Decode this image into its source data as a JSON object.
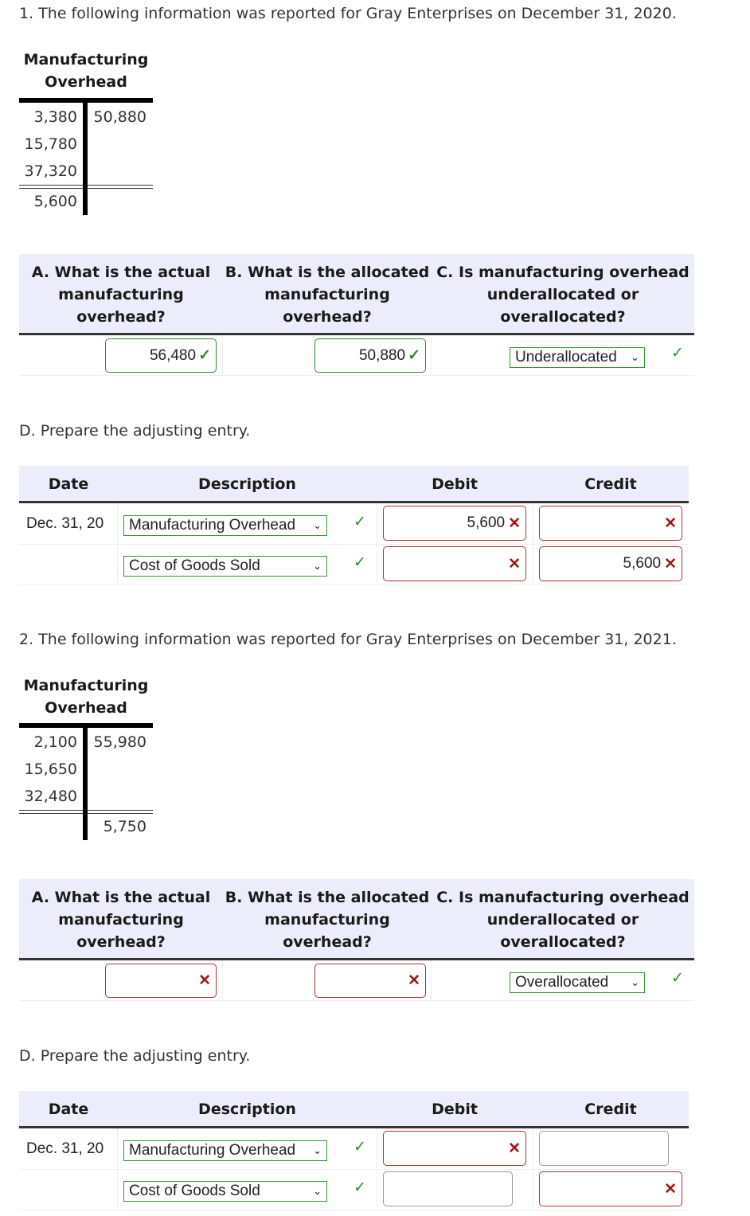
{
  "q1": {
    "title": "1. The following information was reported for Gray Enterprises on December 31, 2020.",
    "taccount": {
      "title_line1": "Manufacturing",
      "title_line2": "Overhead",
      "debits": [
        "3,380",
        "15,780",
        "37,320"
      ],
      "credits": [
        "50,880"
      ],
      "debit_balance": "5,600",
      "credit_balance": ""
    },
    "questions": {
      "a_header": [
        "A. What is the actual",
        "manufacturing",
        "overhead?"
      ],
      "b_header": [
        "B. What is the allocated",
        "manufacturing",
        "overhead?"
      ],
      "c_header": [
        "C. Is manufacturing overhead",
        "underallocated or",
        "overallocated?"
      ],
      "a_value": "56,480",
      "a_status": "correct",
      "b_value": "50,880",
      "b_status": "correct",
      "c_value": "Underallocated",
      "c_status": "correct"
    },
    "journal_prompt": "D. Prepare the adjusting entry.",
    "journal": {
      "headers": {
        "date": "Date",
        "description": "Description",
        "debit": "Debit",
        "credit": "Credit"
      },
      "rows": [
        {
          "date": "Dec. 31, 20",
          "account": "Manufacturing Overhead",
          "account_status": "correct",
          "debit": "5,600",
          "debit_status": "incorrect",
          "credit": "",
          "credit_status": "incorrect"
        },
        {
          "date": "",
          "account": "Cost of Goods Sold",
          "account_status": "correct",
          "debit": "",
          "debit_status": "incorrect",
          "credit": "5,600",
          "credit_status": "incorrect"
        }
      ]
    }
  },
  "q2": {
    "title": "2. The following information was reported for Gray Enterprises on December 31, 2021.",
    "taccount": {
      "title_line1": "Manufacturing",
      "title_line2": "Overhead",
      "debits": [
        "2,100",
        "15,650",
        "32,480"
      ],
      "credits": [
        "55,980"
      ],
      "debit_balance": "",
      "credit_balance": "5,750"
    },
    "questions": {
      "a_header": [
        "A. What is the actual",
        "manufacturing",
        "overhead?"
      ],
      "b_header": [
        "B. What is the allocated",
        "manufacturing",
        "overhead?"
      ],
      "c_header": [
        "C. Is manufacturing overhead",
        "underallocated or",
        "overallocated?"
      ],
      "a_value": "",
      "a_status": "incorrect",
      "b_value": "",
      "b_status": "incorrect",
      "c_value": "Overallocated",
      "c_status": "correct"
    },
    "journal_prompt": "D. Prepare the adjusting entry.",
    "journal": {
      "headers": {
        "date": "Date",
        "description": "Description",
        "debit": "Debit",
        "credit": "Credit"
      },
      "rows": [
        {
          "date": "Dec. 31, 20",
          "account": "Manufacturing Overhead",
          "account_status": "correct",
          "debit": "",
          "debit_status": "incorrect",
          "credit": "",
          "credit_status": "blank"
        },
        {
          "date": "",
          "account": "Cost of Goods Sold",
          "account_status": "correct",
          "debit": "",
          "debit_status": "blank",
          "credit": "",
          "credit_status": "incorrect"
        }
      ]
    }
  },
  "icons": {
    "correct": "✓",
    "incorrect": "✕",
    "chevron": "⌄"
  },
  "colors": {
    "correct": "#2a8a2a",
    "incorrect": "#a31515",
    "header_bg": "#ececfb"
  }
}
